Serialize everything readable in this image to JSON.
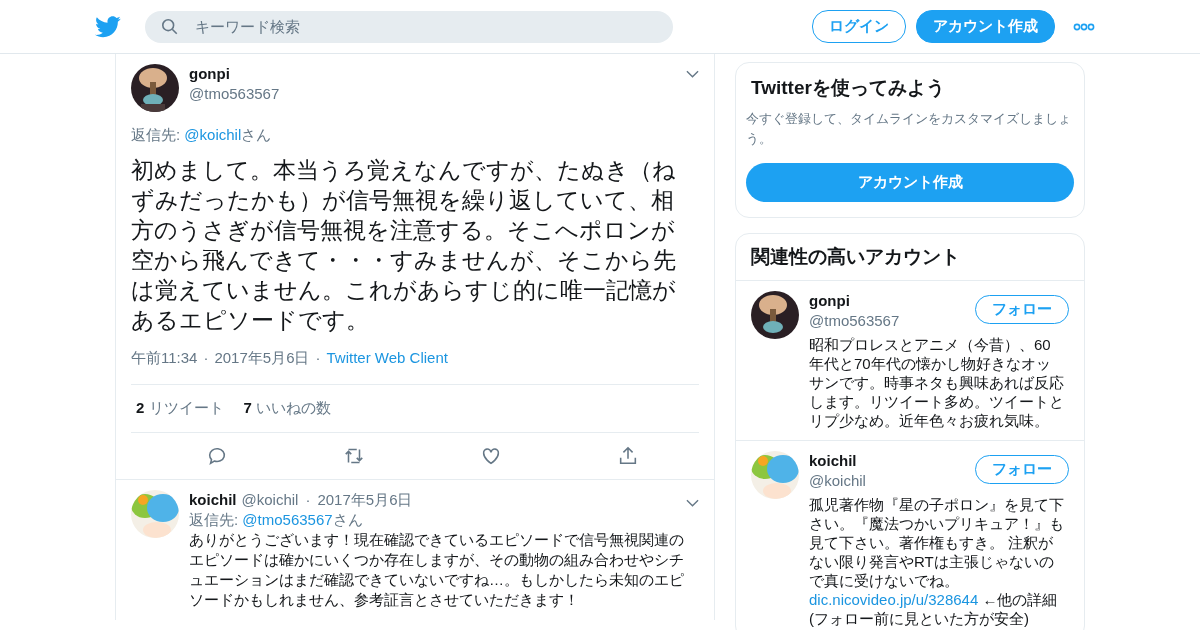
{
  "header": {
    "search": {
      "placeholder": "キーワード検索"
    },
    "login": "ログイン",
    "signup": "アカウント作成"
  },
  "tweet": {
    "name": "gonpi",
    "handle": "@tmo563567",
    "reply_prefix": "返信先: ",
    "reply_to": "@koichil",
    "reply_suffix": "さん",
    "text": "初めまして。本当うろ覚えなんですが、たぬき（ねずみだったかも）が信号無視を繰り返していて、相方のうさぎが信号無視を注意する。そこへポロンが空から飛んできて・・・すみませんが、そこから先は覚えていません。これがあらすじ的に唯一記憶があるエピソードです。",
    "time": "午前11:34",
    "separator": "·",
    "date": "2017年5月6日",
    "source": "Twitter Web Client",
    "stats": [
      {
        "count": "2",
        "label": "リツイート"
      },
      {
        "count": "7",
        "label": "いいねの数"
      }
    ]
  },
  "replies": [
    {
      "name": "koichil",
      "handle": "@koichil",
      "separator": "·",
      "date": "2017年5月6日",
      "reply_prefix": "返信先: ",
      "reply_to": "@tmo563567",
      "reply_suffix": "さん",
      "text": "ありがとうございます！現在確認できているエピソードで信号無視関連のエピソードは確かにいくつか存在しますが、その動物の組み合わせやシチュエーションはまだ確認できていないですね…。もしかしたら未知のエピソードかもしれません、参考証言とさせていただきます！"
    }
  ],
  "signup_card": {
    "title": "Twitterを使ってみよう",
    "text": "今すぐ登録して、タイムラインをカスタマイズしましょう。",
    "button": "アカウント作成"
  },
  "related": {
    "title": "関連性の高いアカウント",
    "accounts": [
      {
        "name": "gonpi",
        "handle": "@tmo563567",
        "follow": "フォロー",
        "bio": "昭和プロレスとアニメ（今昔）、60年代と70年代の懐かし物好きなオッサンです。時事ネタも興味あれば反応します。リツイート多め。ツイートとリプ少なめ。近年色々お疲れ気味。"
      },
      {
        "name": "koichil",
        "handle": "@koichil",
        "follow": "フォロー",
        "bio": "孤児著作物『星の子ポロン』を見て下さい。『魔法つかいプリキュア！』も見て下さい。著作権もすき。 注釈がない限り発言やRTは主張じゃないので真に受けないでね。",
        "link": "dic.nicovideo.jp/u/328644",
        "link_note": " ←他の詳細(フォロー前に見といた方が安全)"
      }
    ]
  }
}
